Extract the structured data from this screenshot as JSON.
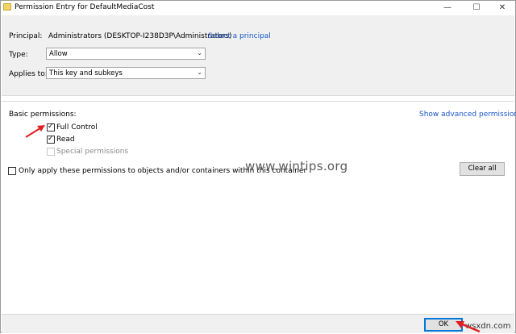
{
  "window": {
    "title": "Permission Entry for DefaultMediaCost",
    "minimize": "—",
    "maximize": "☐",
    "close": "✕"
  },
  "principal": {
    "label": "Principal:",
    "value": "Administrators (DESKTOP-I238D3P\\Administrators)",
    "select_link": "Select a principal"
  },
  "type": {
    "label": "Type:",
    "value": "Allow"
  },
  "applies_to": {
    "label": "Applies to:",
    "value": "This key and subkeys"
  },
  "permissions": {
    "heading": "Basic permissions:",
    "advanced_link": "Show advanced permissions",
    "items": [
      {
        "label": "Full Control",
        "checked": true,
        "enabled": true
      },
      {
        "label": "Read",
        "checked": true,
        "enabled": true
      },
      {
        "label": "Special permissions",
        "checked": false,
        "enabled": false
      }
    ],
    "only_apply_label": "Only apply these permissions to objects and/or containers within this container",
    "clear_all": "Clear all"
  },
  "footer": {
    "ok": "OK"
  },
  "watermarks": {
    "center": "www.wintips.org",
    "corner": "wsxdn.com"
  },
  "colors": {
    "link": "#1a56c8",
    "arrow": "#e02020",
    "panel": "#f0f0f0",
    "ok_border": "#0078d7"
  }
}
